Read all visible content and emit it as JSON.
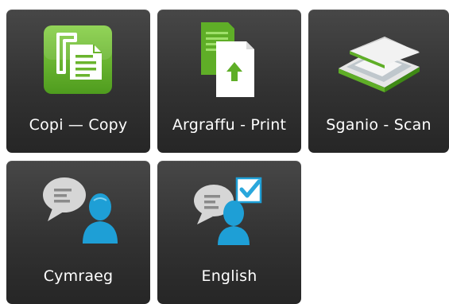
{
  "tiles": {
    "copy": {
      "label": "Copi — Copy",
      "icon": "copy-icon"
    },
    "print": {
      "label": "Argraffu - Print",
      "icon": "print-icon"
    },
    "scan": {
      "label": "Sganio - Scan",
      "icon": "scanner-icon"
    },
    "welsh": {
      "label": "Cymraeg",
      "icon": "person-speech-icon"
    },
    "english": {
      "label": "English",
      "icon": "person-speech-check-icon"
    }
  },
  "colors": {
    "tile_background": "#353535",
    "accent_green": "#6ab42d",
    "person_blue": "#1ea1d8",
    "check_blue": "#2aa7dc"
  }
}
